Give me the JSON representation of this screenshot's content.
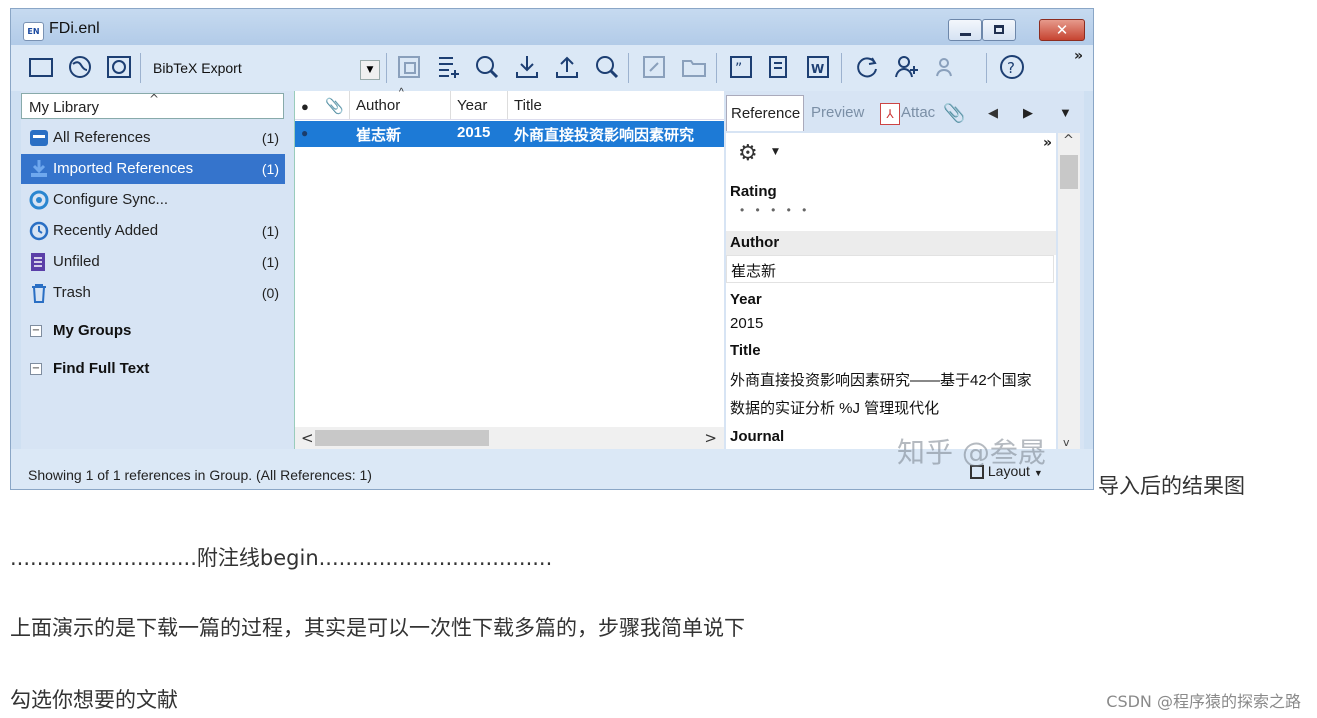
{
  "window": {
    "title": "FDi.enl",
    "logo_text": "EN",
    "close_glyph": "✕"
  },
  "toolbar": {
    "output_style": "BibTeX Export",
    "overflow": "»"
  },
  "groups": {
    "library_label": "My Library",
    "items": [
      {
        "label": "All References",
        "count": "(1)",
        "icon": "all-refs-icon"
      },
      {
        "label": "Imported References",
        "count": "(1)",
        "icon": "import-icon"
      },
      {
        "label": "Configure Sync...",
        "count": "",
        "icon": "sync-icon"
      },
      {
        "label": "Recently Added",
        "count": "(1)",
        "icon": "clock-icon"
      },
      {
        "label": "Unfiled",
        "count": "(1)",
        "icon": "unfiled-icon"
      },
      {
        "label": "Trash",
        "count": "(0)",
        "icon": "trash-icon"
      }
    ],
    "sections": [
      "My Groups",
      "Find Full Text"
    ]
  },
  "reference_list": {
    "columns": [
      "Author",
      "Year",
      "Title"
    ],
    "rows": [
      {
        "author": "崔志新",
        "year": "2015",
        "title": "外商直接投资影响因素研究"
      }
    ]
  },
  "reference_panel": {
    "tabs": [
      "Reference",
      "Preview",
      "Attac"
    ],
    "overflow": "»",
    "fields": [
      {
        "label": "Rating",
        "value": "• • • • •"
      },
      {
        "label": "Author",
        "value": "崔志新"
      },
      {
        "label": "Year",
        "value": "2015"
      },
      {
        "label": "Title",
        "value_lines": [
          "外商直接投资影响因素研究——基于42个国家",
          "数据的实证分析 %J 管理现代化"
        ]
      },
      {
        "label": "Journal",
        "value": ""
      }
    ]
  },
  "status": {
    "text": "Showing 1 of 1 references in Group. (All References: 1)",
    "layout_label": "Layout"
  },
  "watermark": "知乎 @叁晟",
  "article": {
    "caption": "导入后的结果图",
    "p1": "............................附注线begin...................................",
    "p2": "上面演示的是下载一篇的过程，其实是可以一次性下载多篇的，步骤我简单说下",
    "p3": "勾选你想要的文献",
    "source": "CSDN @程序猿的探索之路"
  }
}
